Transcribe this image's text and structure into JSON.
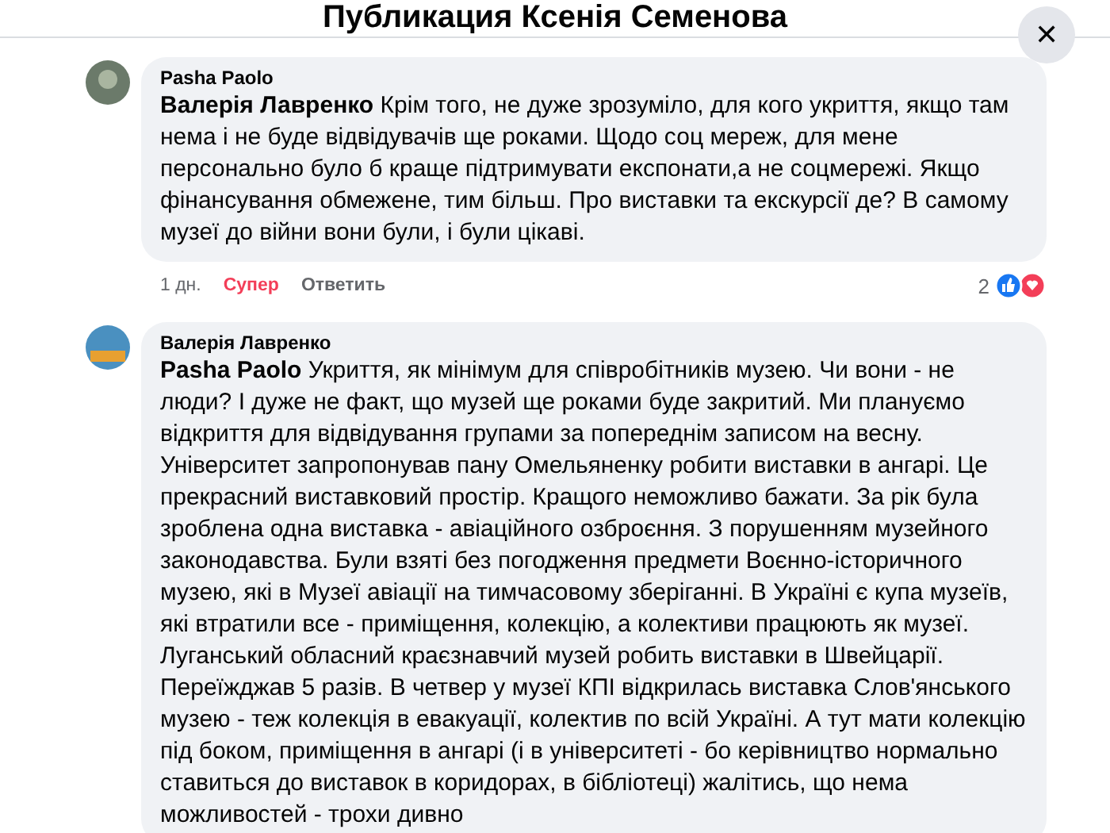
{
  "dialog": {
    "title": "Публикация Ксенія Семенова",
    "close_label": "✕"
  },
  "comments": [
    {
      "author": "Pasha Paolo",
      "text": "**Валерія Лавренко** Крім того, не дуже зрозуміло, для кого укриття, якщо там нема і не буде відвідувачів ще роками. Щодо соц мереж, для мене персонально було б краще підтримувати експонати,а не соцмережі. Якщо фінансування обмежене, тим більш. Про виставки та екскурсії де? В самому музеї до війни вони були, і були цікаві.",
      "time": "1 дн.",
      "reaction": {
        "label": "Супер",
        "selected": true
      },
      "reply_label": "Ответить",
      "reaction_count": "2"
    },
    {
      "author": "Валерія Лавренко",
      "text": "**Pasha Paolo** Укриття, як мінімум для співробітників музею. Чи вони - не люди? І дуже не факт, що музей ще роками буде закритий. Ми плануємо відкриття для відвідування групами за попереднім записом на весну. Університет запропонував пану Омельяненку робити виставки в ангарі. Це прекрасний виставковий простір. Кращого неможливо бажати. За рік була зроблена одна виставка - авіаційного озброєння. З порушенням музейного законодавства. Були взяті без погодження предмети Воєнно-історичного музею, які в Музеї авіації на тимчасовому зберіганні. В Україні є купа музеїв, які втратили все - приміщення, колекцію, а колективи працюють як музеї. Луганський обласний краєзнавчий музей робить виставки в Швейцарії. Переїжджав 5 разів. В четвер у музеї КПІ відкрилась виставка Слов'янського музею - теж колекція в евакуації, колектив по всій Україні. А тут мати колекцію під боком, приміщення в ангарі (і в університеті - бо керівництво нормально ставиться до виставок в коридорах, в бібліотеці) жалітись, що нема можливостей - трохи дивно"
    }
  ]
}
